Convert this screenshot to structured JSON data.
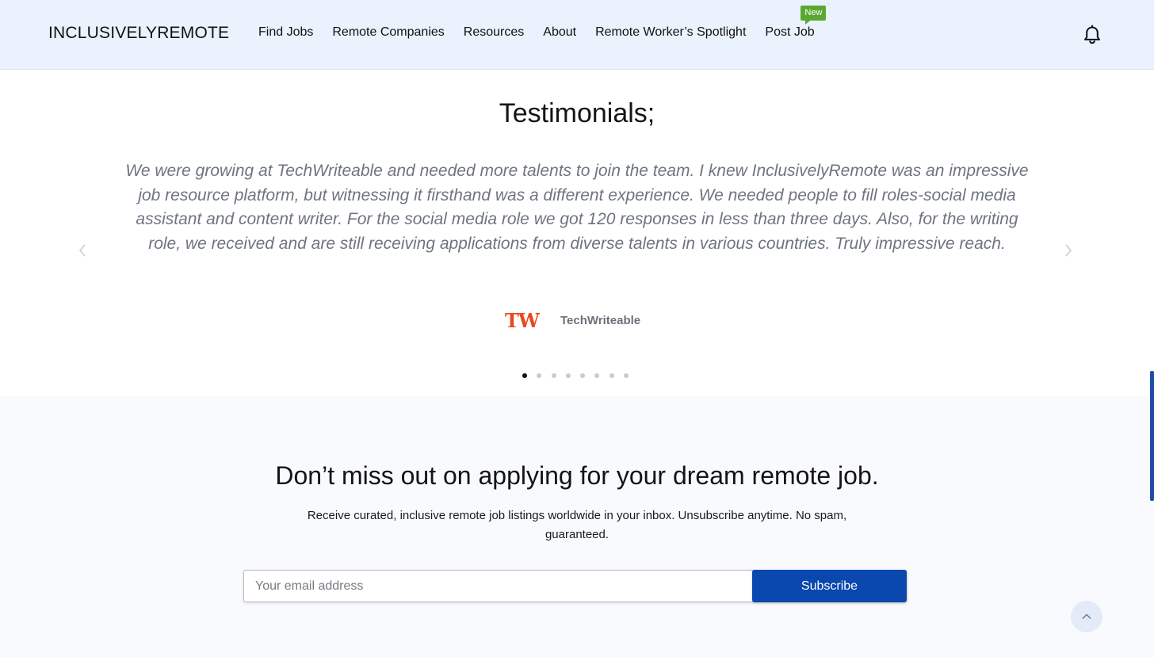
{
  "header": {
    "logo": "INCLUSIVELYREMOTE",
    "nav": [
      {
        "label": "Find Jobs"
      },
      {
        "label": "Remote Companies"
      },
      {
        "label": "Resources"
      },
      {
        "label": "About"
      },
      {
        "label": "Remote Worker’s Spotlight"
      },
      {
        "label": "Post Job"
      }
    ],
    "post_job_badge": "New",
    "notification_icon": "bell-icon"
  },
  "testimonials": {
    "title": "Testimonials;",
    "quote": "We were growing at TechWriteable and needed more talents to join the team. I knew InclusivelyRemote was an impressive job resource platform, but witnessing it firsthand was a different experience. We needed people to fill roles-social media assistant and content writer. For the social media role we got 120 responses in less than three days. Also, for the writing role, we received and are still receiving applications from diverse talents in various countries. Truly impressive reach.",
    "author_logo_text": "TW",
    "author_name": "TechWriteable",
    "prev_icon": "chevron-left-icon",
    "next_icon": "chevron-right-icon",
    "slide_count": 8,
    "active_slide": 1
  },
  "newsletter": {
    "title": "Don’t miss out on applying for your dream remote job.",
    "subtitle": "Receive curated, inclusive remote job listings worldwide in your inbox. Unsubscribe anytime. No spam, guaranteed.",
    "email_placeholder": "Your email address",
    "email_value": "",
    "subscribe_label": "Subscribe",
    "back_to_top_icon": "chevron-up-icon"
  },
  "colors": {
    "header_bg": "#eaf2fd",
    "badge_green": "#5aa832",
    "button_blue": "#0a47ae",
    "tw_logo_orange": "#e8491d",
    "quote_gray": "#6e7480"
  }
}
